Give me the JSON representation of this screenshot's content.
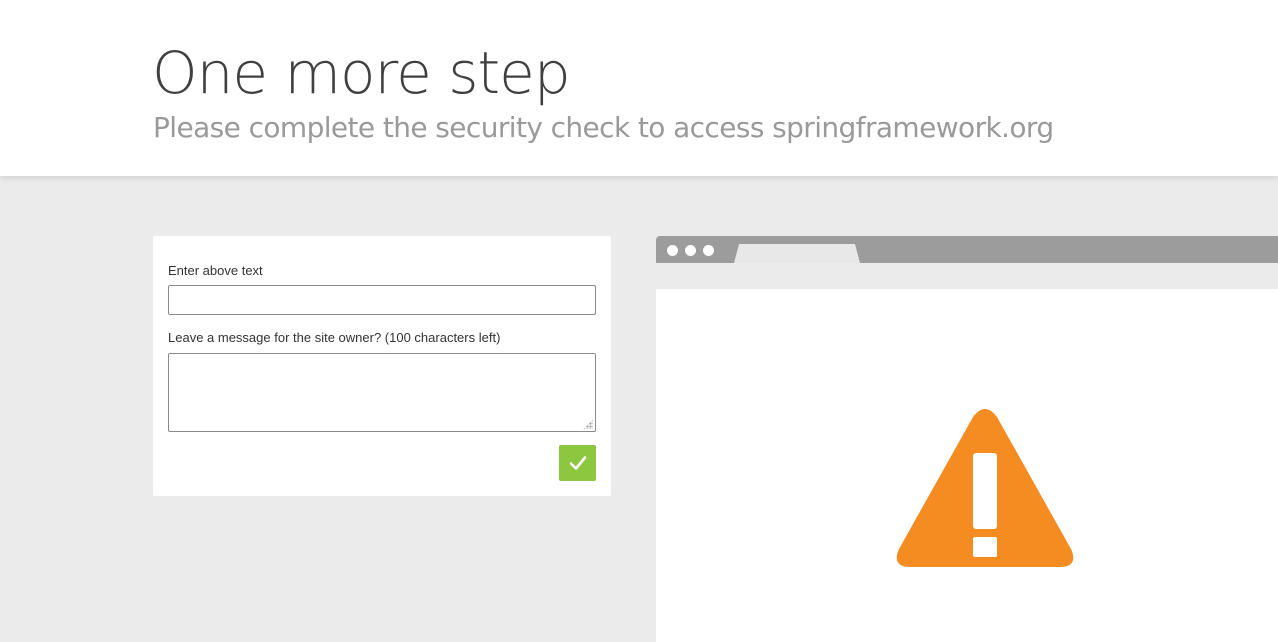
{
  "header": {
    "title": "One more step",
    "subtitle": "Please complete the security check to access springframework.org"
  },
  "form": {
    "captcha_label": "Enter above text",
    "captcha_value": "",
    "message_label": "Leave a message for the site owner? (100 characters left)",
    "message_value": "",
    "submit_icon": "checkmark-icon"
  },
  "browser_illustration": {
    "icon": "warning-icon"
  },
  "colors": {
    "background": "#ebebeb",
    "submit": "#8dc63f",
    "warning": "#f48c21",
    "title": "#404040",
    "subtitle": "#9a9a9a"
  }
}
